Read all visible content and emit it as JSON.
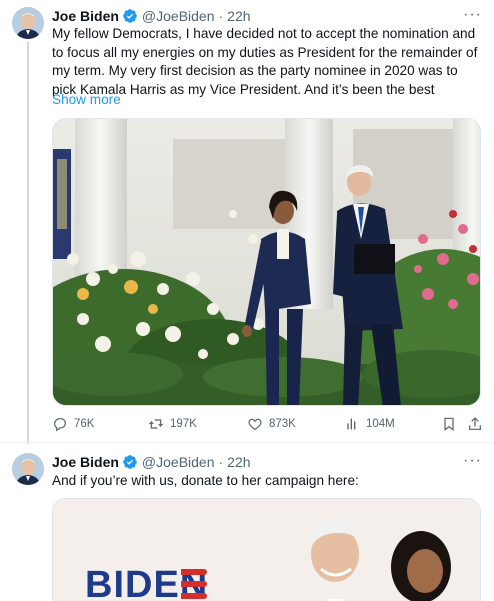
{
  "tweet1": {
    "author_name": "Joe Biden",
    "handle": "@JoeBiden",
    "separator": "·",
    "time": "22h",
    "more": "···",
    "text": "My fellow Democrats, I have decided not to accept the nomination and to focus all my energies on my duties as President for the remainder of my term. My very first decision as the party nominee in 2020 was to pick Kamala Harris as my Vice President. And it’s been the best",
    "show_more": "Show more",
    "stats": {
      "replies": "76K",
      "reposts": "197K",
      "likes": "873K",
      "views": "104M"
    }
  },
  "tweet2": {
    "author_name": "Joe Biden",
    "handle": "@JoeBiden",
    "separator": "·",
    "time": "22h",
    "more": "···",
    "text": "And if you’re with us, donate to her campaign here:",
    "card_logo_text": "BIDEN"
  },
  "colors": {
    "accent_blue": "#1d9bf0",
    "verified_blue": "#1d9bf0",
    "secondary_text": "#536471",
    "biden_navy": "#1e3a8c",
    "biden_red": "#d32f2f"
  },
  "icons": {
    "reply": "reply-icon",
    "repost": "repost-icon",
    "like": "heart-icon",
    "views": "analytics-icon",
    "bookmark": "bookmark-icon",
    "share": "share-icon",
    "verified": "verified-badge-icon",
    "more": "more-icon"
  }
}
